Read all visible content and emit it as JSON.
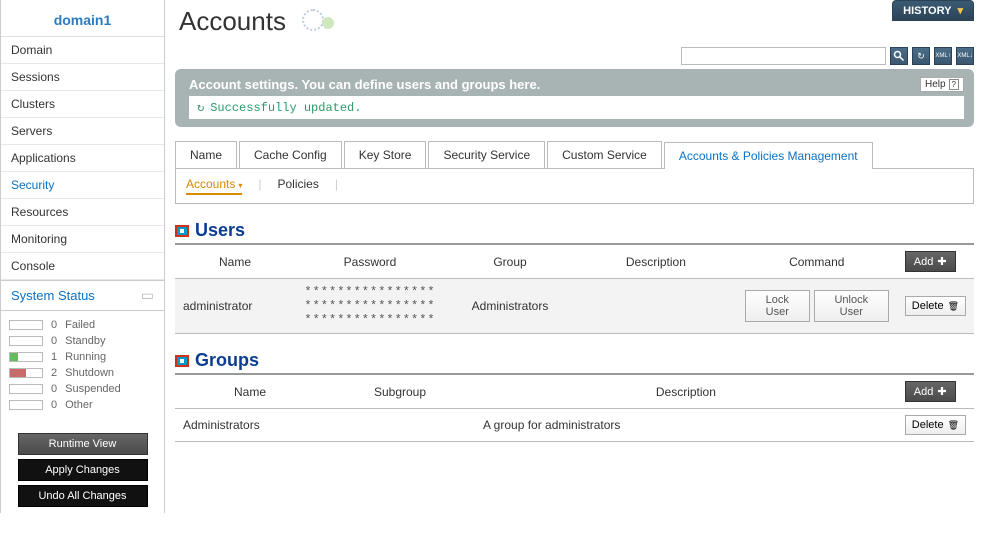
{
  "sidebar": {
    "title": "domain1",
    "items": [
      {
        "label": "Domain"
      },
      {
        "label": "Sessions"
      },
      {
        "label": "Clusters"
      },
      {
        "label": "Servers"
      },
      {
        "label": "Applications"
      },
      {
        "label": "Security",
        "active": true
      },
      {
        "label": "Resources"
      },
      {
        "label": "Monitoring"
      },
      {
        "label": "Console"
      }
    ],
    "status": {
      "title": "System Status",
      "rows": [
        {
          "count": "0",
          "label": "Failed",
          "fill": "#fff",
          "width": "0%"
        },
        {
          "count": "0",
          "label": "Standby",
          "fill": "#fff",
          "width": "0%"
        },
        {
          "count": "1",
          "label": "Running",
          "fill": "#5fbf5f",
          "width": "25%"
        },
        {
          "count": "2",
          "label": "Shutdown",
          "fill": "#c96b6b",
          "width": "50%"
        },
        {
          "count": "0",
          "label": "Suspended",
          "fill": "#fff",
          "width": "0%"
        },
        {
          "count": "0",
          "label": "Other",
          "fill": "#fff",
          "width": "0%"
        }
      ]
    },
    "buttons": {
      "runtime": "Runtime View",
      "apply": "Apply Changes",
      "undo": "Undo All Changes"
    }
  },
  "page": {
    "title": "Accounts",
    "history": "HISTORY",
    "help": "Help",
    "banner_msg": "Account settings. You can define users and groups here.",
    "success": "Successfully updated."
  },
  "tabs": [
    {
      "label": "Name"
    },
    {
      "label": "Cache Config"
    },
    {
      "label": "Key Store"
    },
    {
      "label": "Security Service"
    },
    {
      "label": "Custom Service"
    },
    {
      "label": "Accounts & Policies Management",
      "active": true
    }
  ],
  "subtabs": [
    {
      "label": "Accounts",
      "active": true
    },
    {
      "label": "Policies"
    }
  ],
  "users": {
    "title": "Users",
    "columns": [
      "Name",
      "Password",
      "Group",
      "Description",
      "Command"
    ],
    "add": "Add",
    "rows": [
      {
        "name": "administrator",
        "password": "****************\n****************\n****************",
        "group": "Administrators",
        "description": "",
        "commands": [
          "Lock User",
          "Unlock User"
        ],
        "delete": "Delete"
      }
    ]
  },
  "groups": {
    "title": "Groups",
    "columns": [
      "Name",
      "Subgroup",
      "Description"
    ],
    "add": "Add",
    "rows": [
      {
        "name": "Administrators",
        "subgroup": "",
        "description": "A group for administrators",
        "delete": "Delete"
      }
    ]
  }
}
